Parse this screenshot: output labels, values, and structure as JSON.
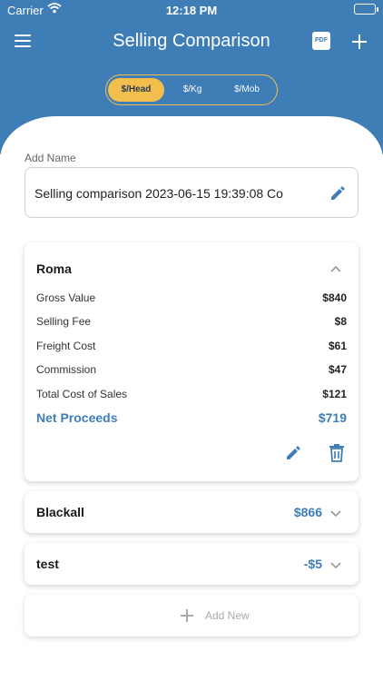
{
  "status_bar": {
    "carrier": "Carrier",
    "time": "12:18 PM"
  },
  "header": {
    "title": "Selling Comparison",
    "pdf_label": "PDF",
    "segments": [
      {
        "label": "$/Head",
        "active": true
      },
      {
        "label": "$/Kg",
        "active": false
      },
      {
        "label": "$/Mob",
        "active": false
      }
    ]
  },
  "name_field": {
    "label": "Add Name",
    "value": "Selling comparison 2023-06-15 19:39:08 Co"
  },
  "cards": {
    "roma": {
      "name": "Roma",
      "rows": [
        {
          "label": "Gross Value",
          "value": "$840"
        },
        {
          "label": "Selling Fee",
          "value": "$8"
        },
        {
          "label": "Freight Cost",
          "value": "$61"
        },
        {
          "label": "Commission",
          "value": "$47"
        },
        {
          "label": "Total Cost of Sales",
          "value": "$121"
        }
      ],
      "net_label": "Net Proceeds",
      "net_value": "$719"
    },
    "blackall": {
      "name": "Blackall",
      "value": "$866"
    },
    "test": {
      "name": "test",
      "value": "-$5"
    }
  },
  "add_new": {
    "label": "Add New"
  },
  "colors": {
    "header": "#3f7db6",
    "accent": "#f2bf4f",
    "blue_text": "#3f7db6"
  }
}
